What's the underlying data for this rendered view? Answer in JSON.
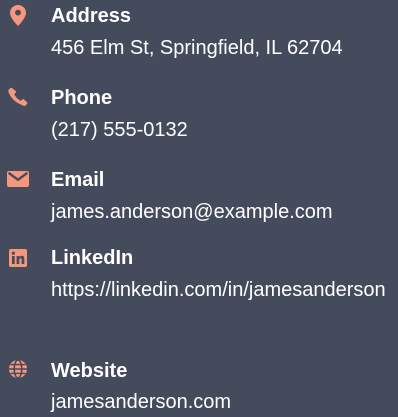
{
  "contacts": [
    {
      "icon": "map-pin-icon",
      "label": "Address",
      "value": "456 Elm St, Springfield, IL 62704"
    },
    {
      "icon": "phone-icon",
      "label": "Phone",
      "value": "(217) 555-0132"
    },
    {
      "icon": "envelope-icon",
      "label": "Email",
      "value": "james.anderson@example.com"
    },
    {
      "icon": "linkedin-icon",
      "label": "LinkedIn",
      "value": "https://linkedin.com/in/jamesanderson"
    },
    {
      "icon": "globe-icon",
      "label": "Website",
      "value": "jamesanderson.com"
    }
  ],
  "colors": {
    "background": "#444b5c",
    "icon_accent": "#f4977c",
    "text": "#ffffff"
  }
}
